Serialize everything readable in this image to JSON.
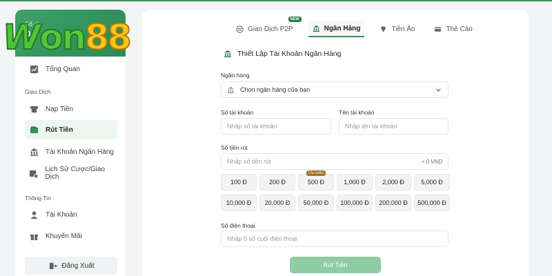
{
  "sidebar": {
    "balance_label": "Số dư",
    "balance_value": "Đ",
    "items": [
      {
        "label": "Tổng Quan"
      },
      {
        "label": "Nạp Tiền"
      },
      {
        "label": "Rút Tiền"
      },
      {
        "label": "Tài Khoản Ngân Hàng"
      },
      {
        "label": "Lịch Sử Cược/Giao Dịch"
      },
      {
        "label": "Tài Khoản"
      },
      {
        "label": "Khuyến Mãi"
      }
    ],
    "sections": [
      "Giao Dịch",
      "Thông Tin"
    ],
    "logout": "Đăng Xuất"
  },
  "logo": {
    "w": "W",
    "on": "on",
    "num": "88"
  },
  "tabs": [
    {
      "label": "Giao Dịch P2P",
      "badge": "NEW"
    },
    {
      "label": "Ngân Hàng"
    },
    {
      "label": "Tiền Ảo"
    },
    {
      "label": "Thẻ Cào"
    }
  ],
  "form": {
    "title": "Thiết Lập Tài Khoản Ngân Hàng",
    "bank_label": "Ngân hàng",
    "bank_placeholder": "Chọn ngân hàng của bạn",
    "account_number_label": "Số tài khoản",
    "account_number_placeholder": "Nhập số tài khoản",
    "account_name_label": "Tên tài khoản",
    "account_name_placeholder": "Nhập tên tài khoản",
    "amount_label": "Số tiền rút",
    "amount_placeholder": "Nhập số tiền rút",
    "amount_suffix": "≈ 0 VND",
    "amounts": [
      "100 Đ",
      "200 Đ",
      "500 Đ",
      "1,000 Đ",
      "2,000 Đ",
      "5,000 Đ",
      "10,000 Đ",
      "20,000 Đ",
      "50,000 Đ",
      "100,000 Đ",
      "200,000 Đ",
      "500,000 Đ"
    ],
    "amount_tag": "Ưu cước",
    "phone_label": "Số điện thoại",
    "phone_placeholder": "Nhập 5 số cuối điện thoại",
    "submit": "Rút Tiền"
  },
  "colors": {
    "accent": "#3b8f5a",
    "submit": "#8fcba3"
  }
}
